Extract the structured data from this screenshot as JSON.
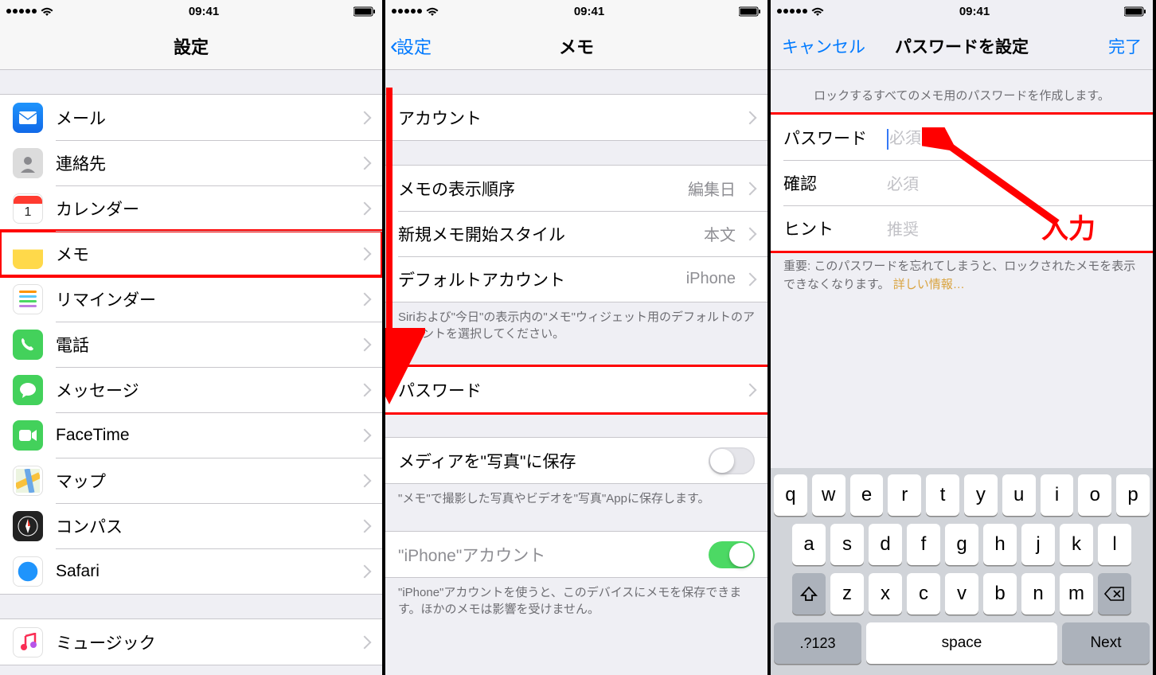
{
  "status": {
    "time": "09:41"
  },
  "annotation": {
    "input_label": "入力"
  },
  "screen1": {
    "title": "設定",
    "items": [
      {
        "name": "mail",
        "label": "メール"
      },
      {
        "name": "contacts",
        "label": "連絡先"
      },
      {
        "name": "calendar",
        "label": "カレンダー"
      },
      {
        "name": "notes",
        "label": "メモ",
        "highlight": true
      },
      {
        "name": "reminders",
        "label": "リマインダー"
      },
      {
        "name": "phone",
        "label": "電話"
      },
      {
        "name": "messages",
        "label": "メッセージ"
      },
      {
        "name": "facetime",
        "label": "FaceTime"
      },
      {
        "name": "maps",
        "label": "マップ"
      },
      {
        "name": "compass",
        "label": "コンパス"
      },
      {
        "name": "safari",
        "label": "Safari"
      }
    ],
    "items2": [
      {
        "name": "music",
        "label": "ミュージック"
      }
    ]
  },
  "screen2": {
    "back": "設定",
    "title": "メモ",
    "accounts_label": "アカウント",
    "sort_label": "メモの表示順序",
    "sort_value": "編集日",
    "newnote_label": "新規メモ開始スタイル",
    "newnote_value": "本文",
    "default_label": "デフォルトアカウント",
    "default_value": "iPhone",
    "default_footer": "Siriおよび\"今日\"の表示内の\"メモ\"ウィジェット用のデフォルトのアカウントを選択してください。",
    "password_label": "パスワード",
    "media_label": "メディアを\"写真\"に保存",
    "media_footer": "\"メモ\"で撮影した写真やビデオを\"写真\"Appに保存します。",
    "iphoneacct_label": "\"iPhone\"アカウント",
    "iphoneacct_footer": "\"iPhone\"アカウントを使うと、このデバイスにメモを保存できます。ほかのメモは影響を受けません。"
  },
  "screen3": {
    "cancel": "キャンセル",
    "title": "パスワードを設定",
    "done": "完了",
    "header": "ロックするすべてのメモ用のパスワードを作成します。",
    "pw_label": "パスワード",
    "pw_placeholder": "必須",
    "verify_label": "確認",
    "verify_placeholder": "必須",
    "hint_label": "ヒント",
    "hint_placeholder": "推奨",
    "footer_warn": "重要: このパスワードを忘れてしまうと、ロックされたメモを表示できなくなります。",
    "footer_link": "詳しい情報…",
    "keyboard": {
      "r1": [
        "q",
        "w",
        "e",
        "r",
        "t",
        "y",
        "u",
        "i",
        "o",
        "p"
      ],
      "r2": [
        "a",
        "s",
        "d",
        "f",
        "g",
        "h",
        "j",
        "k",
        "l"
      ],
      "r3": [
        "z",
        "x",
        "c",
        "v",
        "b",
        "n",
        "m"
      ],
      "fn123": ".?123",
      "space": "space",
      "next": "Next"
    }
  }
}
